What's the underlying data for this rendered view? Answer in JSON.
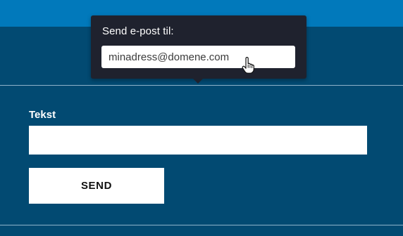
{
  "popover": {
    "label": "Send e-post til:",
    "email_value": "minadress@domene.com",
    "cursor_icon": "hand-pointer-icon"
  },
  "form": {
    "text_label": "Tekst",
    "text_value": "",
    "send_label": "SEND"
  },
  "colors": {
    "header_blue": "#0179bb",
    "background_navy": "#024a72",
    "popover_bg": "#1f222e"
  }
}
